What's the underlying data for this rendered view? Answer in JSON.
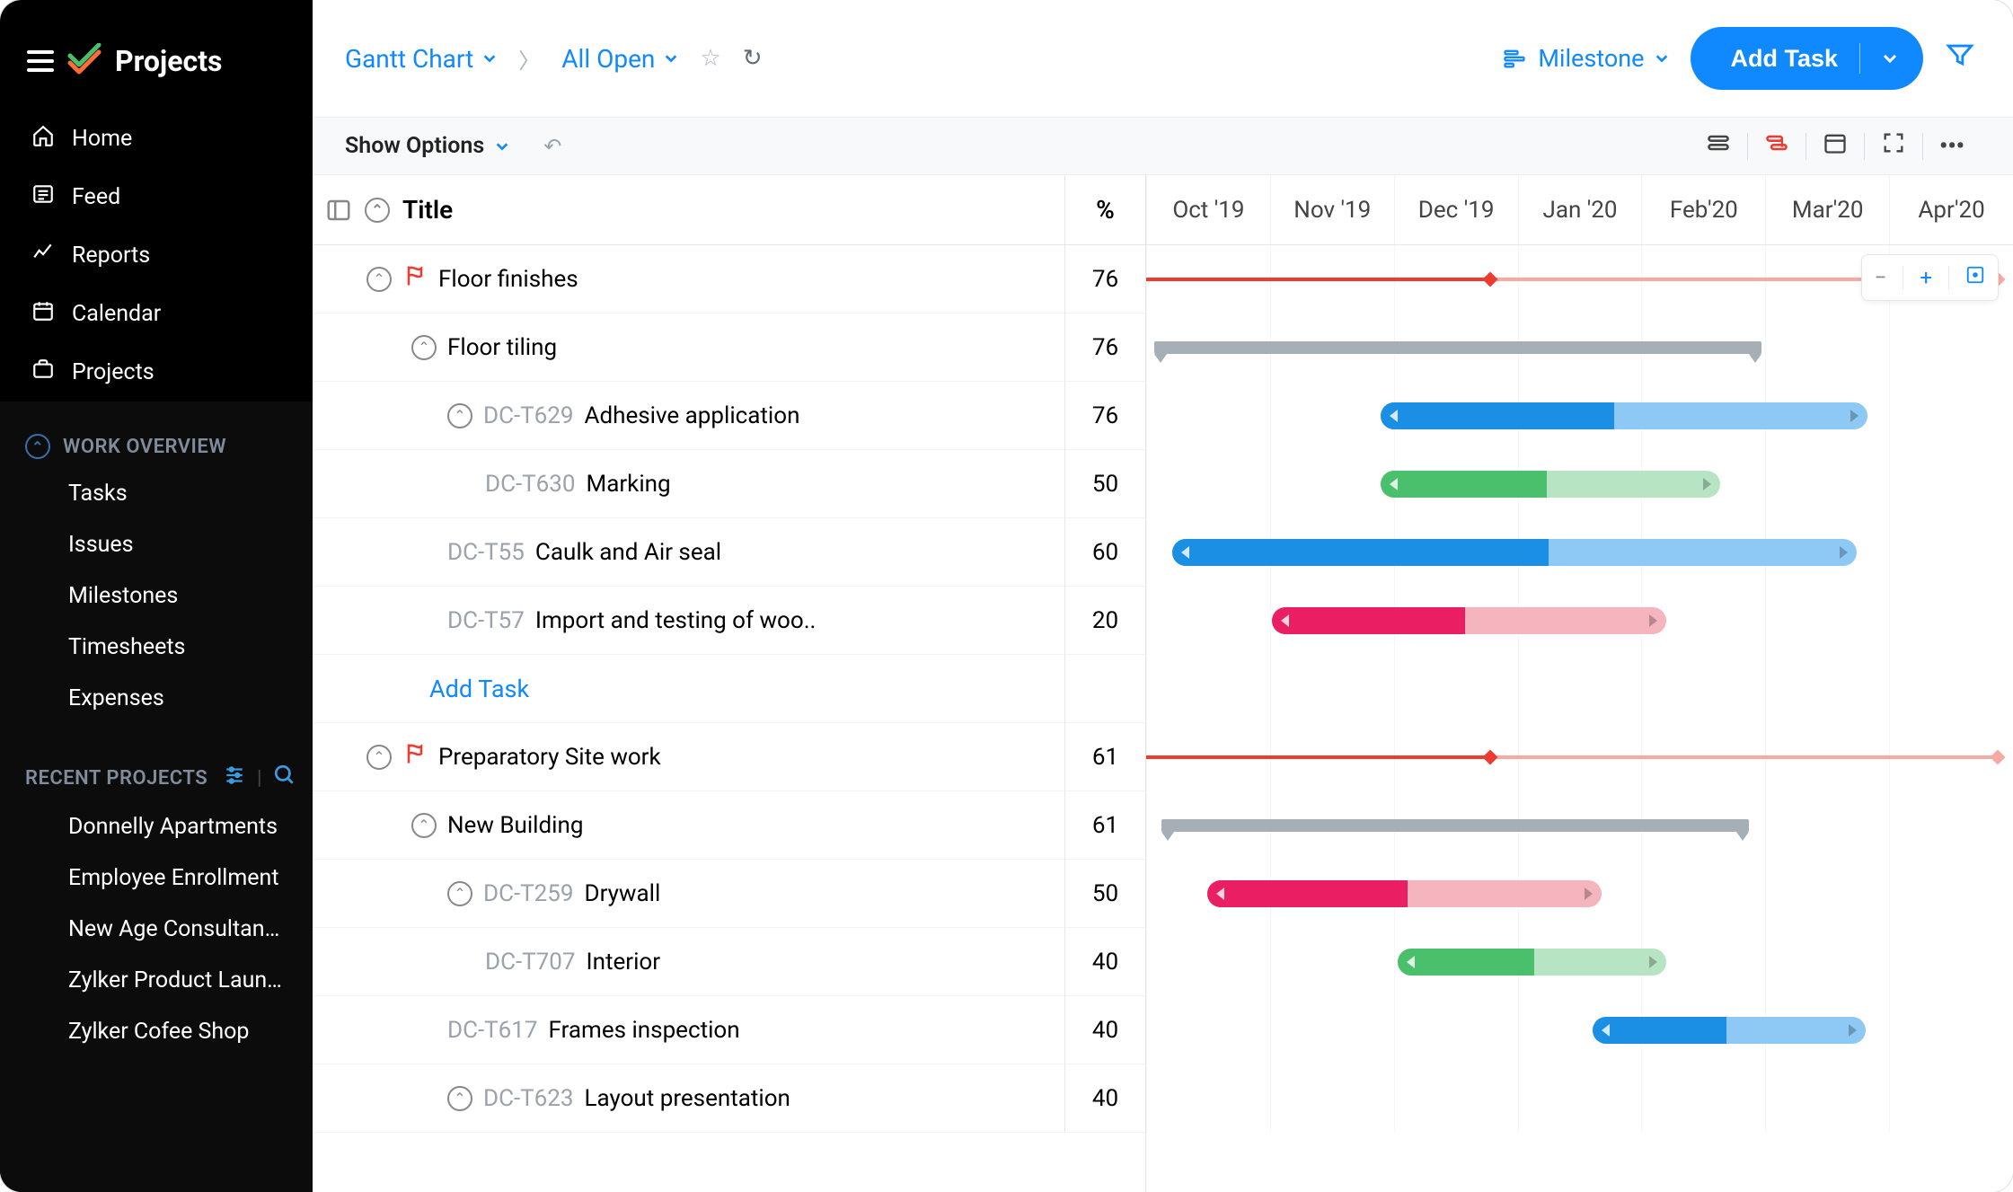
{
  "brand": {
    "name": "Projects"
  },
  "nav": {
    "items": [
      {
        "label": "Home",
        "icon": "home"
      },
      {
        "label": "Feed",
        "icon": "feed"
      },
      {
        "label": "Reports",
        "icon": "reports"
      },
      {
        "label": "Calendar",
        "icon": "calendar"
      },
      {
        "label": "Projects",
        "icon": "projects"
      }
    ]
  },
  "work_overview": {
    "title": "WORK OVERVIEW",
    "items": [
      {
        "label": "Tasks"
      },
      {
        "label": "Issues"
      },
      {
        "label": "Milestones"
      },
      {
        "label": "Timesheets"
      },
      {
        "label": "Expenses"
      }
    ]
  },
  "recent_projects": {
    "title": "RECENT PROJECTS",
    "items": [
      {
        "label": "Donnelly Apartments"
      },
      {
        "label": "Employee Enrollment"
      },
      {
        "label": "New Age Consultancy"
      },
      {
        "label": "Zylker Product Launch"
      },
      {
        "label": "Zylker Cofee Shop"
      }
    ]
  },
  "topbar": {
    "view": "Gantt Chart",
    "filter": "All Open",
    "group_by": "Milestone",
    "add_task": "Add Task"
  },
  "toolbar": {
    "show_options": "Show Options"
  },
  "columns": {
    "title": "Title",
    "pct": "%"
  },
  "months": [
    "Oct '19",
    "Nov '19",
    "Dec '19",
    "Jan '20",
    "Feb'20",
    "Mar'20",
    "Apr'20"
  ],
  "rows": [
    {
      "type": "milestone",
      "name": "Floor finishes",
      "indent": 1,
      "pct": "76",
      "bar": {
        "kind": "mline",
        "start": 0,
        "end1": 39.5,
        "end2": 98
      }
    },
    {
      "type": "tasklist",
      "name": "Floor tiling",
      "indent": 2,
      "pct": "76",
      "bar": {
        "kind": "grey",
        "start": 0.9,
        "end": 71
      }
    },
    {
      "type": "task",
      "id": "DC-T629",
      "name": "Adhesive application",
      "indent": 3,
      "pct": "76",
      "collapse": true,
      "bar": {
        "kind": "task",
        "color": "blue",
        "start": 27.0,
        "end": 83.2,
        "prog": 48
      }
    },
    {
      "type": "task",
      "id": "DC-T630",
      "name": "Marking",
      "indent": 4,
      "pct": "50",
      "bar": {
        "kind": "task",
        "color": "green",
        "start": 27.0,
        "end": 66.2,
        "prog": 49
      }
    },
    {
      "type": "task",
      "id": "DC-T55",
      "name": "Caulk and Air seal",
      "indent": 3,
      "pct": "60",
      "bar": {
        "kind": "task",
        "color": "blue",
        "start": 3.0,
        "end": 82.0,
        "prog": 55
      }
    },
    {
      "type": "task",
      "id": "DC-T57",
      "name": "Import and testing of woo..",
      "indent": 3,
      "pct": "20",
      "bar": {
        "kind": "task",
        "color": "pink",
        "start": 14.5,
        "end": 60.0,
        "prog": 49
      }
    },
    {
      "type": "add_task",
      "label": "Add Task"
    },
    {
      "type": "milestone",
      "name": "Preparatory Site work",
      "indent": 1,
      "pct": "61",
      "bar": {
        "kind": "mline",
        "start": 0,
        "end1": 39.5,
        "end2": 98
      }
    },
    {
      "type": "tasklist",
      "name": "New Building",
      "indent": 2,
      "pct": "61",
      "bar": {
        "kind": "grey",
        "start": 1.8,
        "end": 69.5
      }
    },
    {
      "type": "task",
      "id": "DC-T259",
      "name": "Drywall",
      "indent": 3,
      "pct": "50",
      "collapse": true,
      "bar": {
        "kind": "task",
        "color": "pink",
        "start": 7.0,
        "end": 52.5,
        "prog": 51
      }
    },
    {
      "type": "task",
      "id": "DC-T707",
      "name": "Interior",
      "indent": 4,
      "pct": "40",
      "bar": {
        "kind": "task",
        "color": "green",
        "start": 29.0,
        "end": 60.0,
        "prog": 51
      }
    },
    {
      "type": "task",
      "id": "DC-T617",
      "name": "Frames inspection",
      "indent": 3,
      "pct": "40",
      "bar": {
        "kind": "task",
        "color": "blue",
        "start": 51.5,
        "end": 83.0,
        "prog": 49
      }
    },
    {
      "type": "task",
      "id": "DC-T623",
      "name": "Layout presentation",
      "indent": 3,
      "pct": "40",
      "collapse": true,
      "bar": null
    }
  ],
  "chart_data": {
    "type": "gantt",
    "time_axis": {
      "start": "2019-10",
      "end": "2020-04",
      "ticks": [
        "Oct '19",
        "Nov '19",
        "Dec '19",
        "Jan '20",
        "Feb'20",
        "Mar'20",
        "Apr'20"
      ]
    },
    "rows": [
      {
        "name": "Floor finishes",
        "kind": "milestone-summary",
        "range_pct": [
          0,
          98
        ],
        "actual_pct": 39.5,
        "percent_complete": 76
      },
      {
        "name": "Floor tiling",
        "kind": "tasklist-summary",
        "range_pct": [
          0.9,
          71
        ],
        "percent_complete": 76
      },
      {
        "name": "Adhesive application",
        "id": "DC-T629",
        "kind": "task",
        "range_pct": [
          27.0,
          83.2
        ],
        "progress": 48,
        "color": "blue",
        "percent_complete": 76
      },
      {
        "name": "Marking",
        "id": "DC-T630",
        "kind": "task",
        "range_pct": [
          27.0,
          66.2
        ],
        "progress": 49,
        "color": "green",
        "percent_complete": 50
      },
      {
        "name": "Caulk and Air seal",
        "id": "DC-T55",
        "kind": "task",
        "range_pct": [
          3.0,
          82.0
        ],
        "progress": 55,
        "color": "blue",
        "percent_complete": 60
      },
      {
        "name": "Import and testing of wood",
        "id": "DC-T57",
        "kind": "task",
        "range_pct": [
          14.5,
          60.0
        ],
        "progress": 49,
        "color": "pink",
        "percent_complete": 20
      },
      {
        "name": "Preparatory Site work",
        "kind": "milestone-summary",
        "range_pct": [
          0,
          98
        ],
        "actual_pct": 39.5,
        "percent_complete": 61
      },
      {
        "name": "New Building",
        "kind": "tasklist-summary",
        "range_pct": [
          1.8,
          69.5
        ],
        "percent_complete": 61
      },
      {
        "name": "Drywall",
        "id": "DC-T259",
        "kind": "task",
        "range_pct": [
          7.0,
          52.5
        ],
        "progress": 51,
        "color": "pink",
        "percent_complete": 50
      },
      {
        "name": "Interior",
        "id": "DC-T707",
        "kind": "task",
        "range_pct": [
          29.0,
          60.0
        ],
        "progress": 51,
        "color": "green",
        "percent_complete": 40
      },
      {
        "name": "Frames inspection",
        "id": "DC-T617",
        "kind": "task",
        "range_pct": [
          51.5,
          83.0
        ],
        "progress": 49,
        "color": "blue",
        "percent_complete": 40
      },
      {
        "name": "Layout presentation",
        "id": "DC-T623",
        "kind": "task",
        "range_pct": null,
        "percent_complete": 40
      }
    ]
  }
}
